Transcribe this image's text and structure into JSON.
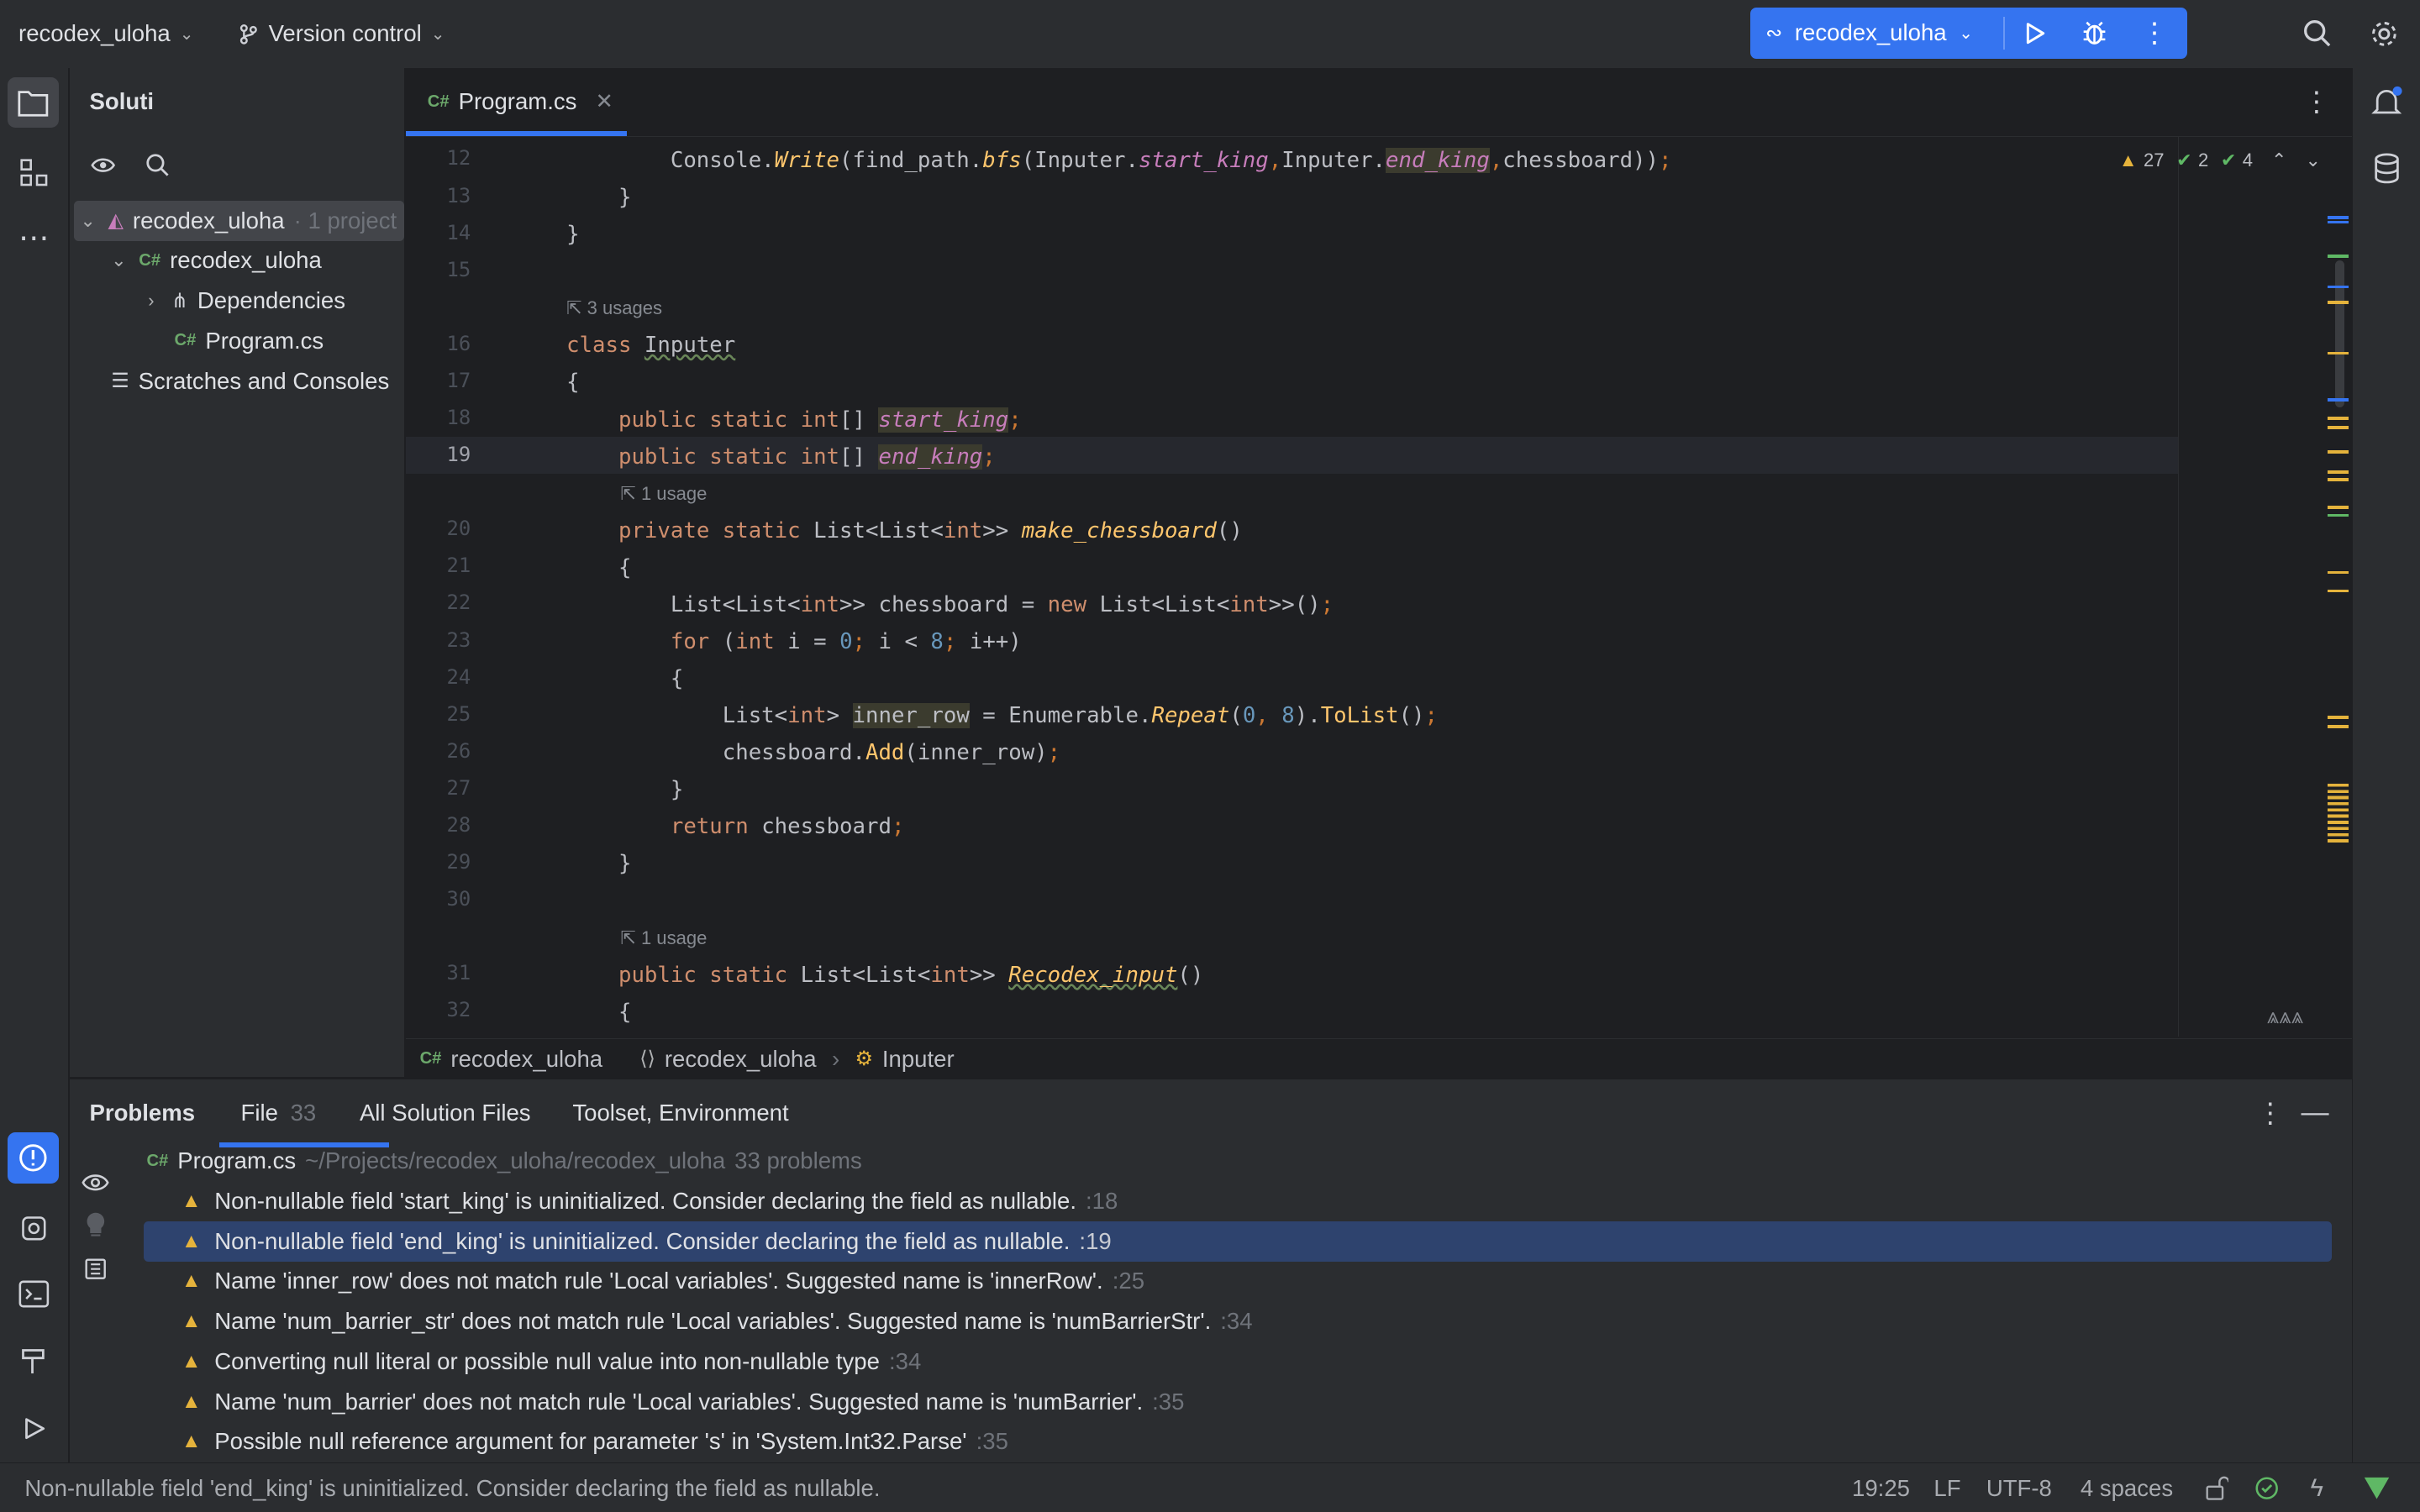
{
  "titlebar": {
    "project": "recodex_uloha",
    "vcs": "Version control",
    "run_config": "recodex_uloha"
  },
  "solution": {
    "title": "Soluti",
    "tree": [
      {
        "label": "recodex_uloha",
        "suffix": "· 1 project"
      },
      {
        "label": "recodex_uloha"
      },
      {
        "label": "Dependencies"
      },
      {
        "label": "Program.cs"
      },
      {
        "label": "Scratches and Consoles"
      }
    ]
  },
  "editor": {
    "tab": "Program.cs",
    "tab_lang": "C#",
    "inspections": {
      "warnings": "27",
      "ok": "2",
      "ok2": "4"
    },
    "hints": {
      "h1": "3 usages",
      "h2": "1 usage",
      "h3": "1 usage"
    },
    "line_numbers": [
      "12",
      "13",
      "14",
      "15",
      "16",
      "17",
      "18",
      "19",
      "20",
      "21",
      "22",
      "23",
      "24",
      "25",
      "26",
      "27",
      "28",
      "29",
      "30",
      "31",
      "32"
    ]
  },
  "breadcrumb": {
    "project": "recodex_uloha",
    "namespace": "recodex_uloha",
    "class": "Inputer"
  },
  "problems": {
    "title": "Problems",
    "tabs": [
      {
        "label": "File",
        "count": "33"
      },
      {
        "label": "All Solution Files"
      },
      {
        "label": "Toolset, Environment"
      }
    ],
    "file": {
      "name": "Program.cs",
      "path": "~/Projects/recodex_uloha/recodex_uloha",
      "count": "33 problems"
    },
    "items": [
      {
        "text": "Non-nullable field 'start_king' is uninitialized. Consider declaring the field as nullable.",
        "line": ":18"
      },
      {
        "text": "Non-nullable field 'end_king' is uninitialized. Consider declaring the field as nullable.",
        "line": ":19"
      },
      {
        "text": "Name 'inner_row' does not match rule 'Local variables'. Suggested name is 'innerRow'.",
        "line": ":25"
      },
      {
        "text": "Name 'num_barrier_str' does not match rule 'Local variables'. Suggested name is 'numBarrierStr'.",
        "line": ":34"
      },
      {
        "text": "Converting null literal or possible null value into non-nullable type",
        "line": ":34"
      },
      {
        "text": "Name 'num_barrier' does not match rule 'Local variables'. Suggested name is 'numBarrier'.",
        "line": ":35"
      },
      {
        "text": "Possible null reference argument for parameter 's' in 'System.Int32.Parse'",
        "line": ":35"
      }
    ]
  },
  "status": {
    "message": "Non-nullable field 'end_king' is uninitialized. Consider declaring the field as nullable.",
    "position": "19:25",
    "line_sep": "LF",
    "encoding": "UTF-8",
    "indent": "4 spaces"
  }
}
